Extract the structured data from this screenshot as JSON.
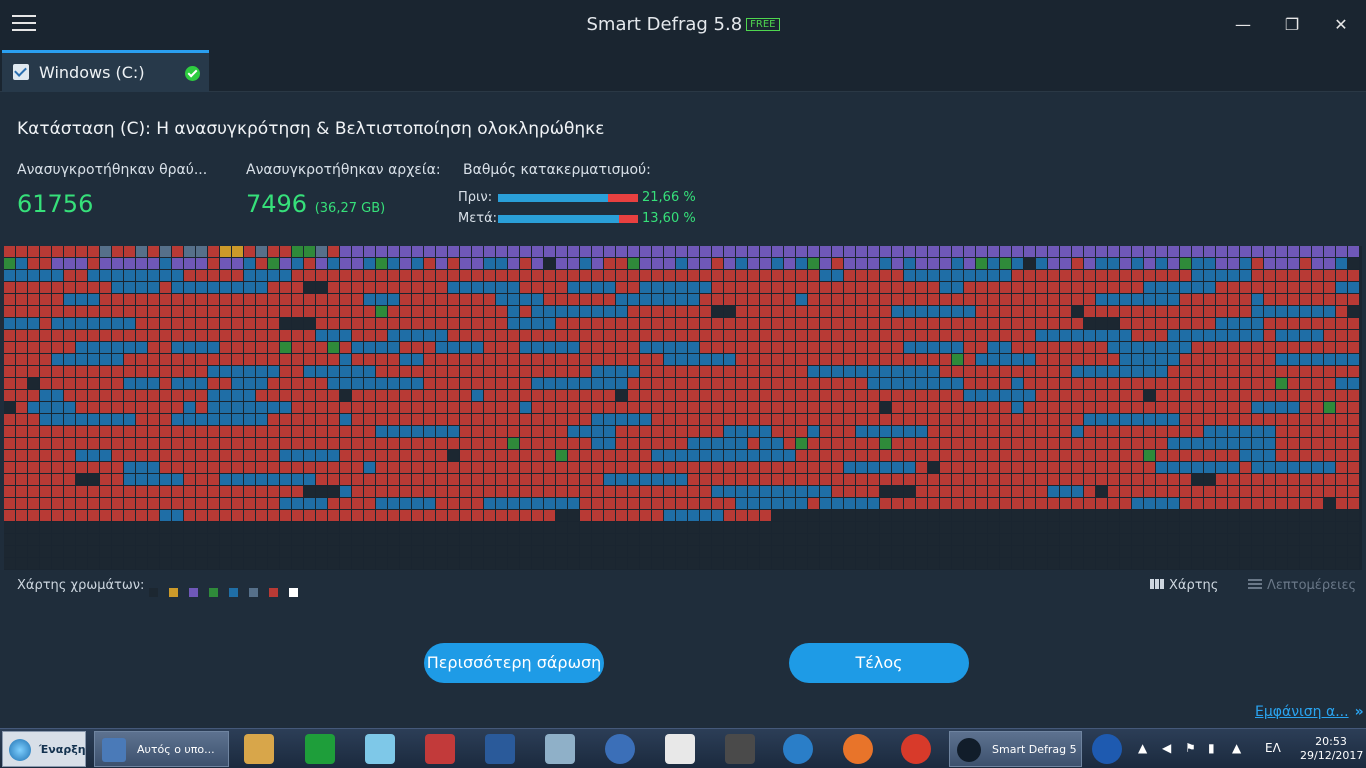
{
  "app": {
    "title": "Smart Defrag 5.8",
    "badge": "FREE",
    "minimize": "—",
    "maximize": "❐",
    "close": "✕"
  },
  "drive_tab": {
    "label": "Windows (C:)",
    "checked": true,
    "status": "done"
  },
  "status": {
    "text": "Κατάσταση (C): Η ανασυγκρότηση & Βελτιστοποίηση ολοκληρώθηκε",
    "fragments_label": "Ανασυγκροτήθηκαν θραύ...",
    "fragments_value": "61756",
    "files_label": "Ανασυγκροτήθηκαν αρχεία:",
    "files_value": "7496",
    "files_size": "(36,27 GB)",
    "frag_label": "Βαθμός κατακερματισμού:",
    "before_label": "Πριν:",
    "before_value": "21,66 %",
    "before_fraction": 0.7834,
    "after_label": "Μετά:",
    "after_value": "13,60 %",
    "after_fraction": 0.864
  },
  "map": {
    "colors": {
      "empty": "#1c2731",
      "used": "#b83a35",
      "fragmented": "#1f6ea6",
      "optimized": "#6f58b8",
      "mft": "#cc9a2a",
      "system": "#2f8a3a",
      "other": "#56708a"
    }
  },
  "legend": {
    "label": "Χάρτης χρωμάτων:",
    "swatches": [
      "#1c2731",
      "#cc9a2a",
      "#6f58b8",
      "#2f8a3a",
      "#1f6ea6",
      "#56708a",
      "#b83a35",
      "#ffffff"
    ]
  },
  "views": {
    "map_label": "Χάρτης",
    "details_label": "Λεπτομέρειες"
  },
  "buttons": {
    "rescan": "Περισσότερη σάρωση",
    "finish": "Τέλος"
  },
  "more_link": {
    "label": "Εμφάνιση α...",
    "arrow": "»"
  },
  "taskbar": {
    "start_label": "Έναρξη",
    "explorer_label": "Αυτός ο υπο...",
    "defrag_label": "Smart Defrag 5",
    "language": "ΕΛ",
    "time": "20:53",
    "date": "29/12/2017",
    "icons": [
      "paint-icon",
      "store-icon",
      "notes-icon",
      "download-icon",
      "network-icon",
      "reader-icon",
      "qbittorrent-icon",
      "flag-icon",
      "media-player-icon",
      "wifi-icon",
      "firefox-icon",
      "chrome-icon"
    ]
  }
}
